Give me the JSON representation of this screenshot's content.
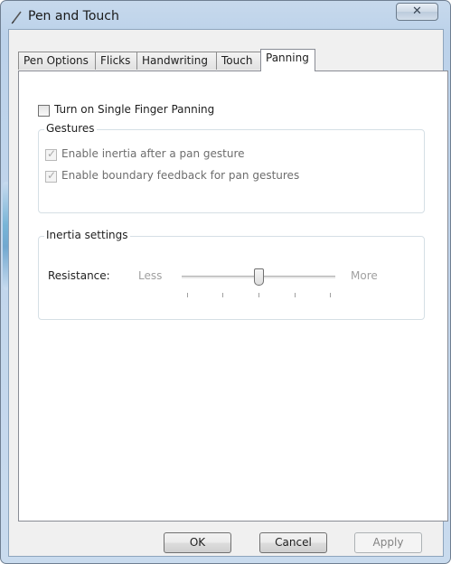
{
  "window": {
    "title": "Pen and Touch",
    "close_label": "✕"
  },
  "tabs": [
    {
      "label": "Pen Options",
      "active": false
    },
    {
      "label": "Flicks",
      "active": false
    },
    {
      "label": "Handwriting",
      "active": false
    },
    {
      "label": "Touch",
      "active": false
    },
    {
      "label": "Panning",
      "active": true
    }
  ],
  "panning": {
    "single_finger_label": "Turn on Single Finger Panning",
    "single_finger_checked": false,
    "gestures": {
      "legend": "Gestures",
      "inertia_label": "Enable inertia after a pan gesture",
      "inertia_checked": true,
      "boundary_label": "Enable boundary feedback for pan gestures",
      "boundary_checked": true
    },
    "inertia_settings": {
      "legend": "Inertia settings",
      "resistance_label": "Resistance:",
      "less_label": "Less",
      "more_label": "More",
      "slider_value": 0.5
    }
  },
  "buttons": {
    "ok": "OK",
    "cancel": "Cancel",
    "apply": "Apply"
  }
}
